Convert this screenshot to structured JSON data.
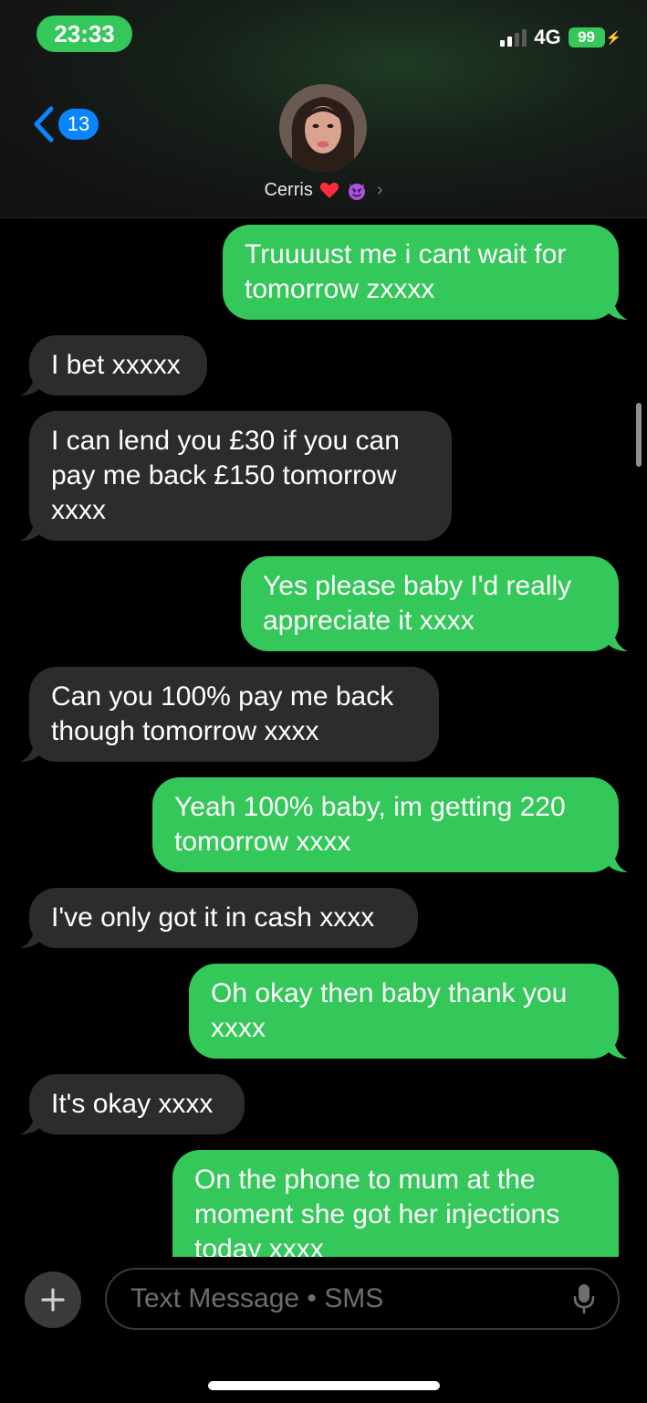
{
  "status_bar": {
    "time": "23:33",
    "network": "4G",
    "battery": "99"
  },
  "header": {
    "back_count": "13",
    "contact_name": "Cerris"
  },
  "colors": {
    "sent": "#34c759",
    "received": "#2c2c2e",
    "accent": "#0a84ff"
  },
  "messages": [
    {
      "direction": "sent",
      "text": "Truuuust me i cant wait for tomorrow zxxxx"
    },
    {
      "direction": "received",
      "text": "I bet xxxxx"
    },
    {
      "direction": "received",
      "text": "I can lend you £30 if you can pay me back £150 tomorrow xxxx"
    },
    {
      "direction": "sent",
      "text": "Yes please baby I'd really appreciate it xxxx"
    },
    {
      "direction": "received",
      "text": "Can you 100% pay me back though tomorrow xxxx"
    },
    {
      "direction": "sent",
      "text": "Yeah 100% baby, im getting 220 tomorrow xxxx"
    },
    {
      "direction": "received",
      "text": "I've only got it in cash xxxx"
    },
    {
      "direction": "sent",
      "text": "Oh okay then baby thank you xxxx"
    },
    {
      "direction": "received",
      "text": "It's okay xxxx"
    },
    {
      "direction": "sent",
      "text": "On the phone to mum at the moment she got her injections today xxxx"
    }
  ],
  "compose": {
    "placeholder": "Text Message • SMS"
  }
}
